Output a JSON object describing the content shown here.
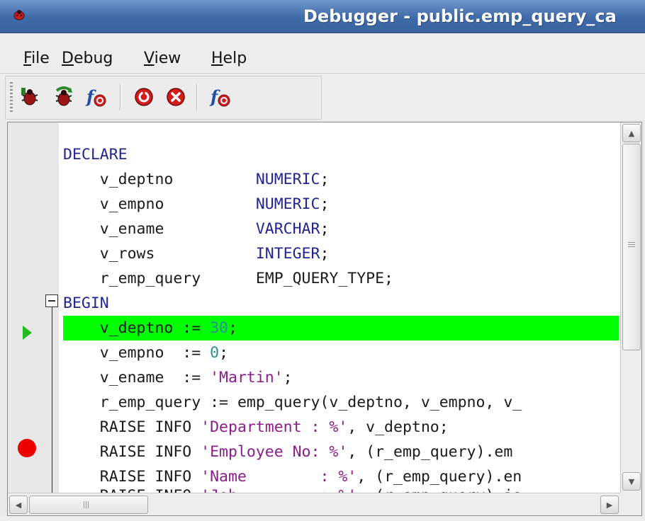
{
  "window": {
    "title": "Debugger - public.emp_query_ca"
  },
  "menu": {
    "file": {
      "u": "F",
      "rest": "ile"
    },
    "debug": {
      "u": "D",
      "rest": "ebug"
    },
    "view": {
      "u": "V",
      "rest": "iew"
    },
    "help": {
      "u": "H",
      "rest": "elp"
    }
  },
  "toolbar": {
    "buttons": [
      {
        "icon": "step-into-icon"
      },
      {
        "icon": "step-over-icon"
      },
      {
        "icon": "continue-function-icon"
      },
      {
        "icon": "stop-icon"
      },
      {
        "icon": "restart-icon"
      },
      {
        "icon": "set-breakpoint-function-icon"
      }
    ]
  },
  "editor": {
    "lines": [
      {
        "t1": "DECLARE"
      },
      {
        "t1": "    v_deptno         ",
        "t2": "NUMERIC",
        "t3": ";"
      },
      {
        "t1": "    v_empno          ",
        "t2": "NUMERIC",
        "t3": ";"
      },
      {
        "t1": "    v_ename          ",
        "t2": "VARCHAR",
        "t3": ";"
      },
      {
        "t1": "    v_rows           ",
        "t2": "INTEGER",
        "t3": ";"
      },
      {
        "t1": "    r_emp_query      EMP_QUERY_TYPE;"
      },
      {
        "t1": "BEGIN"
      },
      {
        "t1": "    v_deptno := ",
        "t2": "30",
        "t3": ";"
      },
      {
        "t1": "    v_empno  := ",
        "t2": "0",
        "t3": ";"
      },
      {
        "t1": "    v_ename  := ",
        "t2": "'Martin'",
        "t3": ";"
      },
      {
        "t1": "    r_emp_query := emp_query(v_deptno, v_empno, v_"
      },
      {
        "t1": "    RAISE INFO ",
        "t2": "'Department : %'",
        "t3": ", v_deptno;"
      },
      {
        "t1": "    RAISE INFO ",
        "t2": "'Employee No: %'",
        "t3": ", (r_emp_query).em"
      },
      {
        "t1": "    RAISE INFO ",
        "t2": "'Name        : %'",
        "t3": ", (r_emp_query).en"
      },
      {
        "t1": "    RAISE INFO ",
        "t2": "'Job         : %'",
        "t3": ", (r_emp_query).jo"
      }
    ]
  },
  "colors": {
    "current_line": "#00ff00",
    "breakpoint": "#ee0000",
    "keyword": "#21268e",
    "number": "#2b9090",
    "string": "#8a1d8a"
  },
  "scrollbars": {
    "up": "▲",
    "down": "▼",
    "left": "◀",
    "right": "▶",
    "hgrip": "|||"
  }
}
